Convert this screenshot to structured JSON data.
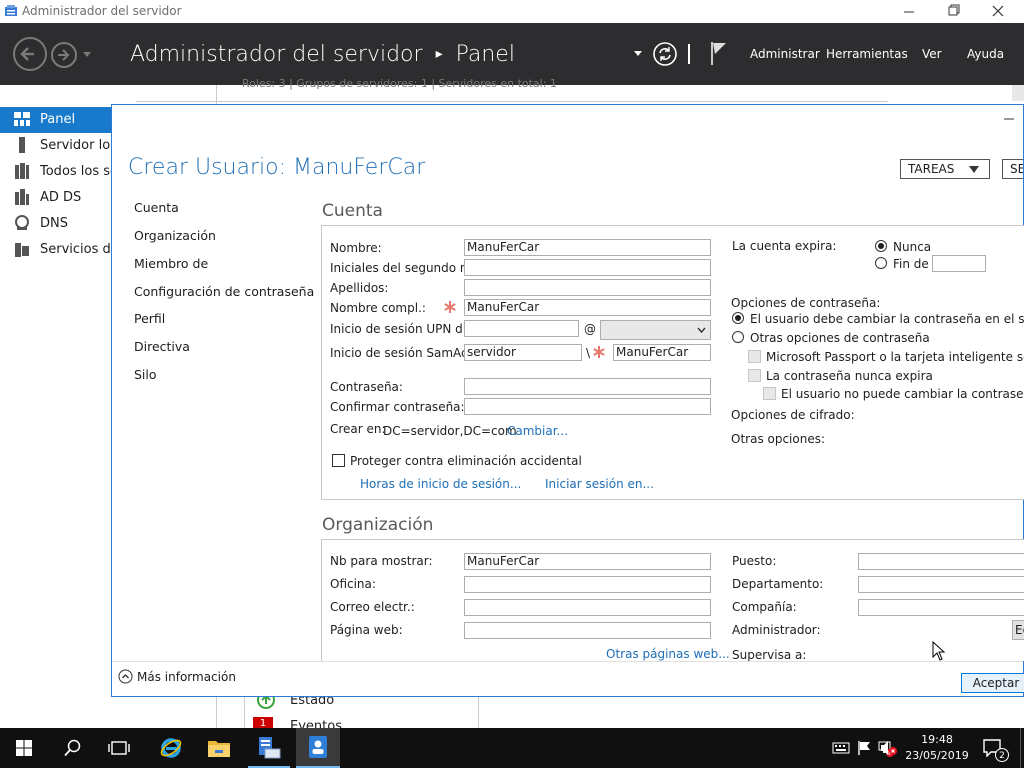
{
  "window": {
    "title": "Administrador del servidor"
  },
  "header": {
    "breadcrumb_root": "Administrador del servidor",
    "breadcrumb_sep": "▸",
    "breadcrumb_page": "Panel",
    "menu": [
      "Administrar",
      "Herramientas",
      "Ver",
      "Ayuda"
    ]
  },
  "sidebar": {
    "items": [
      {
        "label": "Panel",
        "icon": "dashboard-icon"
      },
      {
        "label": "Servidor local",
        "icon": "server-icon"
      },
      {
        "label": "Todos los servidores",
        "icon": "servers-icon"
      },
      {
        "label": "AD DS",
        "icon": "ad-ds-icon"
      },
      {
        "label": "DNS",
        "icon": "dns-icon"
      },
      {
        "label": "Servicios de archivos",
        "icon": "file-services-icon"
      }
    ]
  },
  "background": {
    "strip_text": "Roles: 3   |   Grupos de servidores: 1   |   Servidores en total: 1",
    "tile_status": "Estado",
    "tile_events_count": "1",
    "tile_events": "Eventos"
  },
  "dialog": {
    "title": "Crear Usuario: ManuFerCar",
    "tasks_label": "TAREAS",
    "sections_label": "SECCIONES",
    "nav": [
      "Cuenta",
      "Organización",
      "Miembro de",
      "Configuración de contraseña",
      "Perfil",
      "Directiva",
      "Silo"
    ],
    "more_info": "Más información",
    "ok_button": "Aceptar",
    "edit_button": "Editar..."
  },
  "account": {
    "heading": "Cuenta",
    "nombre_label": "Nombre:",
    "nombre_value": "ManuFerCar",
    "iniciales_label": "Iniciales del segundo n...",
    "iniciales_value": "",
    "apellidos_label": "Apellidos:",
    "apellidos_value": "",
    "nombre_compl_label": "Nombre compl.:",
    "nombre_compl_value": "ManuFerCar",
    "upn_label": "Inicio de sesión UPN d...",
    "upn_value": "",
    "upn_at": "@",
    "upn_domain": "",
    "sam_label": "Inicio de sesión SamAc...",
    "sam_domain": "servidor",
    "sam_sep": "\\",
    "sam_value": "ManuFerCar",
    "password_label": "Contraseña:",
    "confirm_label": "Confirmar contraseña:",
    "create_in_label": "Crear en:",
    "create_in_value": "DC=servidor,DC=com",
    "change_link": "Cambiar...",
    "protect_label": "Proteger contra eliminación accidental",
    "protect_checked": false,
    "logon_hours_link": "Horas de inicio de sesión...",
    "logon_to_link": "Iniciar sesión en...",
    "expires_label": "La cuenta expira:",
    "expires_never": "Nunca",
    "expires_end": "Fin de",
    "expires_selected": "Nunca",
    "pwd_options_label": "Opciones de contraseña:",
    "pwd_must_change": "El usuario debe cambiar la contraseña en el siguiente inicio de sesión",
    "pwd_other": "Otras opciones de contraseña",
    "pwd_smartcard": "Microsoft Passport o la tarjeta inteligente son necesarios",
    "pwd_never_expires": "La contraseña nunca expira",
    "pwd_cannot_change": "El usuario no puede cambiar la contraseña",
    "encryption_label": "Opciones de cifrado:",
    "other_options_label": "Otras opciones:"
  },
  "organization": {
    "heading": "Organización",
    "display_label": "Nb para mostrar:",
    "display_value": "ManuFerCar",
    "office_label": "Oficina:",
    "office_value": "",
    "email_label": "Correo electr.:",
    "email_value": "",
    "web_label": "Página web:",
    "web_value": "",
    "other_web_link": "Otras páginas web...",
    "job_label": "Puesto:",
    "dept_label": "Departamento:",
    "company_label": "Compañía:",
    "manager_label": "Administrador:",
    "supervises_label": "Supervisa a:"
  },
  "taskbar": {
    "time": "19:48",
    "date": "23/05/2019",
    "notification_count": "2"
  },
  "colors": {
    "header_bg": "#2d2d30",
    "accent": "#1979ca",
    "title_blue": "#1f6fb8",
    "required": "#e8786d",
    "taskbar": "#101010"
  }
}
